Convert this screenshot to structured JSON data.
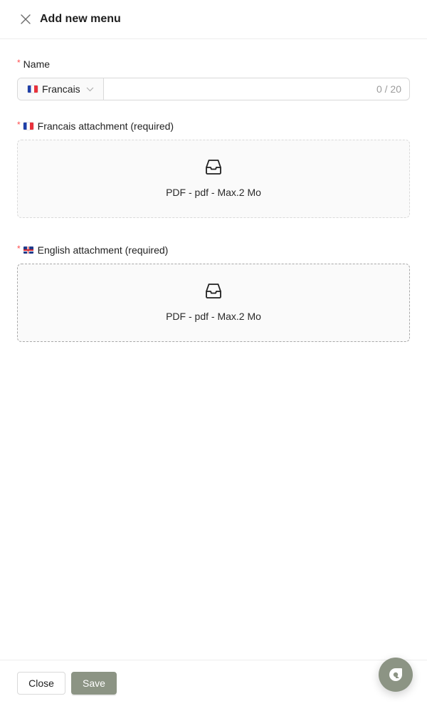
{
  "header": {
    "title": "Add new menu"
  },
  "name_field": {
    "required_mark": "*",
    "label": "Name",
    "language": "Francais",
    "language_flag": "flag-fr",
    "value": "",
    "counter": "0 / 20"
  },
  "attachments": [
    {
      "required_mark": "*",
      "flag": "flag-fr",
      "label": "Francais attachment (required)",
      "icon": "inbox-icon",
      "hint": "PDF - pdf - Max.2 Mo"
    },
    {
      "required_mark": "*",
      "flag": "flag-gb",
      "label": "English attachment (required)",
      "icon": "inbox-icon",
      "hint": "PDF - pdf - Max.2 Mo"
    }
  ],
  "footer": {
    "close_label": "Close",
    "save_label": "Save"
  },
  "colors": {
    "primary": "#8c9484",
    "required": "#ff4d4f",
    "border": "#d9d9d9"
  }
}
